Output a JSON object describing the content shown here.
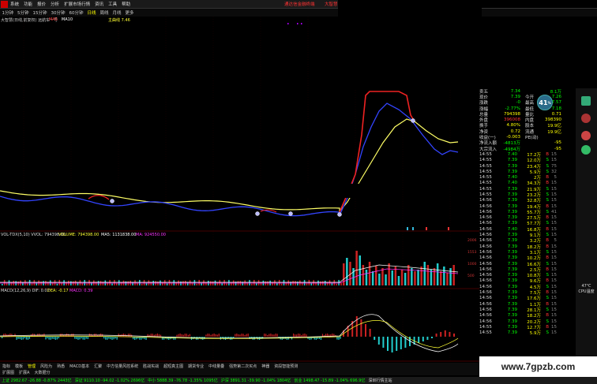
{
  "menu": {
    "items": [
      "系统",
      "功能",
      "报价",
      "分析",
      "扩展市场行情",
      "资讯",
      "工具",
      "帮助"
    ],
    "promo": "通达信金融终端",
    "brand": "大智慧"
  },
  "timeframes": {
    "items": [
      "1分钟",
      "5分钟",
      "15分钟",
      "30分钟",
      "60分钟",
      "日线",
      "周线",
      "月线",
      "更多"
    ],
    "active": "日线"
  },
  "chart": {
    "title": "大智慧(日线,前复权) 远航车一号",
    "ma_labels": [
      {
        "text": "MA5",
        "color": "#ff3b3b"
      },
      {
        "text": "MA10",
        "color": "#ffffff"
      },
      {
        "text": "主曲线 7.46",
        "color": "#ffff33"
      }
    ],
    "volume_label": "VOL-TDX(5,10) VVOL: 794398.00",
    "volume_values": [
      {
        "text": "VOLUME: 794398.00",
        "color": "#ffff33"
      },
      {
        "text": "MA5: 1131838.00",
        "color": "#ffffff"
      },
      {
        "text": "MA: 924550.00",
        "color": "#ff33ff"
      }
    ],
    "macd_label": "MACD(12,26,9) DIF: 0.02",
    "macd_values": [
      {
        "text": "DEA: -0.17",
        "color": "#ffff33"
      },
      {
        "text": "MACD: 0.39",
        "color": "#ff33ff"
      }
    ]
  },
  "quote": {
    "top": [
      {
        "l": "卖五",
        "v": "7.34",
        "l2": "",
        "v2": "8.1万"
      },
      {
        "l": "现价",
        "v": "7.39",
        "l2": "今开",
        "v2": "7.26"
      },
      {
        "l": "涨跌",
        "v": "-0",
        "l2": "最高",
        "v2": "7.57"
      },
      {
        "l": "涨幅",
        "v": "-2.77%",
        "l2": "最低",
        "v2": "7.18"
      },
      {
        "l": "总量",
        "v": "794398",
        "l2": "量比",
        "v2": "0.71"
      },
      {
        "l": "外盘",
        "v": "396008",
        "l2": "内盘",
        "v2": "398390"
      },
      {
        "l": "换手",
        "v": "4.80%",
        "l2": "股本",
        "v2": "19.9亿"
      },
      {
        "l": "净资",
        "v": "0.72",
        "l2": "流通",
        "v2": "19.9亿"
      },
      {
        "l": "收益(一)",
        "v": "-0.003",
        "l2": "PE(动)",
        "v2": ""
      },
      {
        "l": "净流入额",
        "v": "-4813万",
        "l2": "",
        "v2": "-95"
      },
      {
        "l": "大宗流入",
        "v": "-4984万",
        "l2": "",
        "v2": "-95"
      }
    ],
    "ticks": [
      {
        "t": "14:55",
        "p": "7.40",
        "v": "17.2万",
        "bs": "B",
        "n": "15"
      },
      {
        "t": "14:55",
        "p": "7.39",
        "v": "12.0万",
        "bs": "S",
        "n": "15"
      },
      {
        "t": "14:55",
        "p": "7.39",
        "v": "23.4万",
        "bs": "S",
        "n": "75"
      },
      {
        "t": "14:55",
        "p": "7.39",
        "v": "5.9万",
        "bs": "S",
        "n": "32"
      },
      {
        "t": "14:55",
        "p": "7.40",
        "v": "2万",
        "bs": "B",
        "n": "5"
      },
      {
        "t": "14:55",
        "p": "7.40",
        "v": "34.3万",
        "bs": "B",
        "n": "15"
      },
      {
        "t": "14:55",
        "p": "7.39",
        "v": "21.9万",
        "bs": "S",
        "n": "15"
      },
      {
        "t": "14:55",
        "p": "7.39",
        "v": "23.2万",
        "bs": "S",
        "n": "15"
      },
      {
        "t": "14:56",
        "p": "7.39",
        "v": "32.8万",
        "bs": "S",
        "n": "15"
      },
      {
        "t": "14:56",
        "p": "7.39",
        "v": "19.4万",
        "bs": "B",
        "n": "15"
      },
      {
        "t": "14:56",
        "p": "7.39",
        "v": "55.7万",
        "bs": "S",
        "n": "41"
      },
      {
        "t": "14:56",
        "p": "7.39",
        "v": "27.5万",
        "bs": "B",
        "n": "15"
      },
      {
        "t": "14:56",
        "p": "7.39",
        "v": "57.7万",
        "bs": "S",
        "n": "15"
      },
      {
        "t": "14:56",
        "p": "7.40",
        "v": "16.8万",
        "bs": "B",
        "n": "15"
      },
      {
        "t": "14:56",
        "p": "7.39",
        "v": "9.1万",
        "bs": "S",
        "n": "15"
      },
      {
        "t": "14:56",
        "p": "7.39",
        "v": "3.2万",
        "bs": "B",
        "n": "5"
      },
      {
        "t": "14:56",
        "p": "7.39",
        "v": "18.2万",
        "bs": "B",
        "n": "15"
      },
      {
        "t": "14:56",
        "p": "7.39",
        "v": "3.1万",
        "bs": "S",
        "n": "15"
      },
      {
        "t": "14:56",
        "p": "7.39",
        "v": "10.2万",
        "bs": "B",
        "n": "15"
      },
      {
        "t": "14:56",
        "p": "7.39",
        "v": "16.6万",
        "bs": "S",
        "n": "15"
      },
      {
        "t": "14:56",
        "p": "7.39",
        "v": "2.5万",
        "bs": "B",
        "n": "15"
      },
      {
        "t": "14:56",
        "p": "7.39",
        "v": "10.8万",
        "bs": "S",
        "n": "15"
      },
      {
        "t": "14:56",
        "p": "7.39",
        "v": "9.6万",
        "bs": "B",
        "n": "15"
      },
      {
        "t": "14:56",
        "p": "7.39",
        "v": "4.5万",
        "bs": "S",
        "n": "15"
      },
      {
        "t": "14:56",
        "p": "7.39",
        "v": "7.5万",
        "bs": "B",
        "n": "15"
      },
      {
        "t": "14:56",
        "p": "7.39",
        "v": "17.6万",
        "bs": "S",
        "n": "15"
      },
      {
        "t": "14:56",
        "p": "7.39",
        "v": "1.1万",
        "bs": "B",
        "n": "15"
      },
      {
        "t": "14:56",
        "p": "7.39",
        "v": "28.1万",
        "bs": "S",
        "n": "15"
      },
      {
        "t": "14:56",
        "p": "7.39",
        "v": "18.2万",
        "bs": "B",
        "n": "15"
      },
      {
        "t": "14:56",
        "p": "7.39",
        "v": "20.2万",
        "bs": "S",
        "n": "15"
      },
      {
        "t": "14:55",
        "p": "7.39",
        "v": "12.7万",
        "bs": "B",
        "n": "15"
      },
      {
        "t": "14:55",
        "p": "7.39",
        "v": "5.9万",
        "bs": "S",
        "n": "15"
      }
    ]
  },
  "badge": {
    "text": "41",
    "unit": "%"
  },
  "temperature": {
    "value": "47℃",
    "label": "CPU温度"
  },
  "tabs": [
    "指标",
    "模板",
    "管理",
    "风险为",
    "熟悉",
    "MACD基本",
    "汇聚",
    "中方信量风控系统",
    "胜战实战",
    "超短真主图",
    "期货专业",
    "中线量叠",
    "强势第二次买点",
    "神器",
    "资段智能预测"
  ],
  "tabs_active": "管理",
  "tabs2": [
    "扩展图",
    "扩展A",
    "大数据分"
  ],
  "status": [
    {
      "text": "上证 2982.67 -26.88 -0.87% 2443亿",
      "color": "#0f0"
    },
    {
      "text": "深证 9110.10 -94.02 -1.02% 2696亿",
      "color": "#0f0"
    },
    {
      "text": "中小 5888.39 -76.78 -1.35% 1095亿",
      "color": "#0f0"
    },
    {
      "text": "沪深 3891.31 -39.90 -1.04% 1804亿",
      "color": "#0f0"
    },
    {
      "text": "创业 1498.47 -15.89 -1.04% 696.9亿",
      "color": "#0f0"
    },
    {
      "text": "深圳行情主站",
      "color": "#ddd"
    }
  ],
  "watermark": "www.7gpzb.com"
}
